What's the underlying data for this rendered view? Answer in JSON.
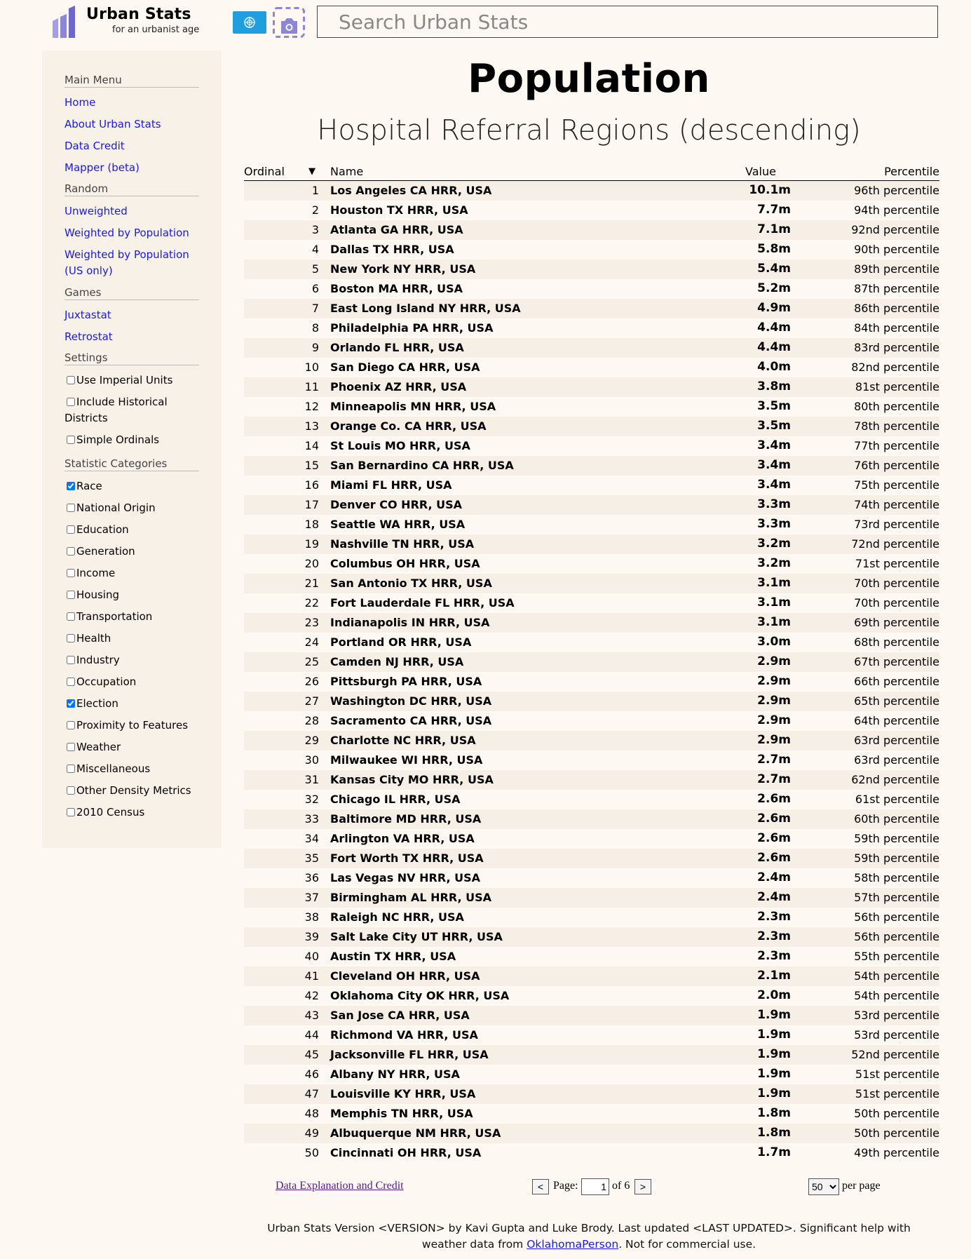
{
  "header": {
    "brand_title": "Urban Stats",
    "brand_subtitle": "for an urbanist age",
    "search_placeholder": "Search Urban Stats"
  },
  "sidebar": {
    "main_menu_heading": "Main Menu",
    "main_links": [
      "Home",
      "About Urban Stats",
      "Data Credit",
      "Mapper (beta)"
    ],
    "random_heading": "Random",
    "random_links": [
      "Unweighted",
      "Weighted by Population",
      "Weighted by Population (US only)"
    ],
    "games_heading": "Games",
    "games_links": [
      "Juxtastat",
      "Retrostat"
    ],
    "settings_heading": "Settings",
    "settings": [
      {
        "label": "Use Imperial Units",
        "checked": false
      },
      {
        "label": "Include Historical Districts",
        "checked": false
      },
      {
        "label": "Simple Ordinals",
        "checked": false
      }
    ],
    "categories_heading": "Statistic Categories",
    "categories": [
      {
        "label": "Race",
        "checked": true
      },
      {
        "label": "National Origin",
        "checked": false
      },
      {
        "label": "Education",
        "checked": false
      },
      {
        "label": "Generation",
        "checked": false
      },
      {
        "label": "Income",
        "checked": false
      },
      {
        "label": "Housing",
        "checked": false
      },
      {
        "label": "Transportation",
        "checked": false
      },
      {
        "label": "Health",
        "checked": false
      },
      {
        "label": "Industry",
        "checked": false
      },
      {
        "label": "Occupation",
        "checked": false
      },
      {
        "label": "Election",
        "checked": true
      },
      {
        "label": "Proximity to Features",
        "checked": false
      },
      {
        "label": "Weather",
        "checked": false
      },
      {
        "label": "Miscellaneous",
        "checked": false
      },
      {
        "label": "Other Density Metrics",
        "checked": false
      },
      {
        "label": "2010 Census",
        "checked": false
      }
    ]
  },
  "main": {
    "title": "Population",
    "subtitle": "Hospital Referral Regions (descending)"
  },
  "table": {
    "col_ordinal": "Ordinal",
    "sort_glyph": "▼",
    "col_name": "Name",
    "col_value": "Value",
    "col_percentile": "Percentile",
    "rows": [
      [
        "1",
        "Los Angeles CA HRR, USA",
        "10.1m",
        "96th percentile"
      ],
      [
        "2",
        "Houston TX HRR, USA",
        "7.7m",
        "94th percentile"
      ],
      [
        "3",
        "Atlanta GA HRR, USA",
        "7.1m",
        "92nd percentile"
      ],
      [
        "4",
        "Dallas TX HRR, USA",
        "5.8m",
        "90th percentile"
      ],
      [
        "5",
        "New York NY HRR, USA",
        "5.4m",
        "89th percentile"
      ],
      [
        "6",
        "Boston MA HRR, USA",
        "5.2m",
        "87th percentile"
      ],
      [
        "7",
        "East Long Island NY HRR, USA",
        "4.9m",
        "86th percentile"
      ],
      [
        "8",
        "Philadelphia PA HRR, USA",
        "4.4m",
        "84th percentile"
      ],
      [
        "9",
        "Orlando FL HRR, USA",
        "4.4m",
        "83rd percentile"
      ],
      [
        "10",
        "San Diego CA HRR, USA",
        "4.0m",
        "82nd percentile"
      ],
      [
        "11",
        "Phoenix AZ HRR, USA",
        "3.8m",
        "81st percentile"
      ],
      [
        "12",
        "Minneapolis MN HRR, USA",
        "3.5m",
        "80th percentile"
      ],
      [
        "13",
        "Orange Co. CA HRR, USA",
        "3.5m",
        "78th percentile"
      ],
      [
        "14",
        "St Louis MO HRR, USA",
        "3.4m",
        "77th percentile"
      ],
      [
        "15",
        "San Bernardino CA HRR, USA",
        "3.4m",
        "76th percentile"
      ],
      [
        "16",
        "Miami FL HRR, USA",
        "3.4m",
        "75th percentile"
      ],
      [
        "17",
        "Denver CO HRR, USA",
        "3.3m",
        "74th percentile"
      ],
      [
        "18",
        "Seattle WA HRR, USA",
        "3.3m",
        "73rd percentile"
      ],
      [
        "19",
        "Nashville TN HRR, USA",
        "3.2m",
        "72nd percentile"
      ],
      [
        "20",
        "Columbus OH HRR, USA",
        "3.2m",
        "71st percentile"
      ],
      [
        "21",
        "San Antonio TX HRR, USA",
        "3.1m",
        "70th percentile"
      ],
      [
        "22",
        "Fort Lauderdale FL HRR, USA",
        "3.1m",
        "70th percentile"
      ],
      [
        "23",
        "Indianapolis IN HRR, USA",
        "3.1m",
        "69th percentile"
      ],
      [
        "24",
        "Portland OR HRR, USA",
        "3.0m",
        "68th percentile"
      ],
      [
        "25",
        "Camden NJ HRR, USA",
        "2.9m",
        "67th percentile"
      ],
      [
        "26",
        "Pittsburgh PA HRR, USA",
        "2.9m",
        "66th percentile"
      ],
      [
        "27",
        "Washington DC HRR, USA",
        "2.9m",
        "65th percentile"
      ],
      [
        "28",
        "Sacramento CA HRR, USA",
        "2.9m",
        "64th percentile"
      ],
      [
        "29",
        "Charlotte NC HRR, USA",
        "2.9m",
        "63rd percentile"
      ],
      [
        "30",
        "Milwaukee WI HRR, USA",
        "2.7m",
        "63rd percentile"
      ],
      [
        "31",
        "Kansas City MO HRR, USA",
        "2.7m",
        "62nd percentile"
      ],
      [
        "32",
        "Chicago IL HRR, USA",
        "2.6m",
        "61st percentile"
      ],
      [
        "33",
        "Baltimore MD HRR, USA",
        "2.6m",
        "60th percentile"
      ],
      [
        "34",
        "Arlington VA HRR, USA",
        "2.6m",
        "59th percentile"
      ],
      [
        "35",
        "Fort Worth TX HRR, USA",
        "2.6m",
        "59th percentile"
      ],
      [
        "36",
        "Las Vegas NV HRR, USA",
        "2.4m",
        "58th percentile"
      ],
      [
        "37",
        "Birmingham AL HRR, USA",
        "2.4m",
        "57th percentile"
      ],
      [
        "38",
        "Raleigh NC HRR, USA",
        "2.3m",
        "56th percentile"
      ],
      [
        "39",
        "Salt Lake City UT HRR, USA",
        "2.3m",
        "56th percentile"
      ],
      [
        "40",
        "Austin TX HRR, USA",
        "2.3m",
        "55th percentile"
      ],
      [
        "41",
        "Cleveland OH HRR, USA",
        "2.1m",
        "54th percentile"
      ],
      [
        "42",
        "Oklahoma City OK HRR, USA",
        "2.0m",
        "54th percentile"
      ],
      [
        "43",
        "San Jose CA HRR, USA",
        "1.9m",
        "53rd percentile"
      ],
      [
        "44",
        "Richmond VA HRR, USA",
        "1.9m",
        "53rd percentile"
      ],
      [
        "45",
        "Jacksonville FL HRR, USA",
        "1.9m",
        "52nd percentile"
      ],
      [
        "46",
        "Albany NY HRR, USA",
        "1.9m",
        "51st percentile"
      ],
      [
        "47",
        "Louisville KY HRR, USA",
        "1.9m",
        "51st percentile"
      ],
      [
        "48",
        "Memphis TN HRR, USA",
        "1.8m",
        "50th percentile"
      ],
      [
        "49",
        "Albuquerque NM HRR, USA",
        "1.8m",
        "50th percentile"
      ],
      [
        "50",
        "Cincinnati OH HRR, USA",
        "1.7m",
        "49th percentile"
      ]
    ]
  },
  "pager": {
    "data_link": "Data Explanation and Credit",
    "prev_label": "<",
    "page_label": "Page:",
    "page_value": "1",
    "of_label": "of 6",
    "next_label": ">",
    "per_page_value": "50",
    "per_page_label": "per page"
  },
  "footer": {
    "text_before": "Urban Stats Version <VERSION> by Kavi Gupta and Luke Brody. Last updated <LAST UPDATED>. Significant help with weather data from ",
    "link_text": "OklahomaPerson",
    "text_after": ". Not for commercial use."
  },
  "colors": {
    "background": "#fdf8f2",
    "sidebar_bg": "#f7f1e8",
    "link": "#1a1ae6",
    "row_stripe": "#f5efe5",
    "flag_blue": "#1f9ee0",
    "logo_purple": "#8c85d8"
  }
}
